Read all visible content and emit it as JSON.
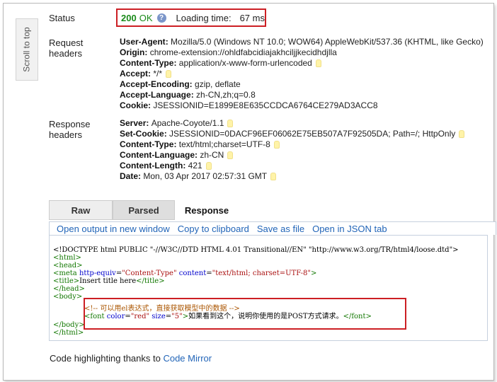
{
  "scroll_to_top": "Scroll to top",
  "status": {
    "label": "Status",
    "code": "200",
    "text": "OK",
    "loading_label": "Loading time:",
    "loading_value": "67 ms"
  },
  "request_headers": {
    "label_line1": "Request",
    "label_line2": "headers",
    "items": [
      {
        "name": "User-Agent",
        "value": "Mozilla/5.0 (Windows NT 10.0; WOW64) AppleWebKit/537.36 (KHTML, like Gecko)",
        "bulb": false
      },
      {
        "name": "Origin",
        "value": "chrome-extension://ohldfabcidiajakhciljjkecidhdjlla",
        "bulb": false
      },
      {
        "name": "Content-Type",
        "value": "application/x-www-form-urlencoded",
        "bulb": true
      },
      {
        "name": "Accept",
        "value": "*/*",
        "bulb": true
      },
      {
        "name": "Accept-Encoding",
        "value": "gzip, deflate",
        "bulb": false
      },
      {
        "name": "Accept-Language",
        "value": "zh-CN,zh;q=0.8",
        "bulb": false
      },
      {
        "name": "Cookie",
        "value": "JSESSIONID=E1899E8E635CCDCA6764CE279AD3ACC8",
        "bulb": false
      }
    ]
  },
  "response_headers": {
    "label_line1": "Response",
    "label_line2": "headers",
    "items": [
      {
        "name": "Server",
        "value": "Apache-Coyote/1.1",
        "bulb": true
      },
      {
        "name": "Set-Cookie",
        "value": "JSESSIONID=0DACF96EF06062E75EB507A7F92505DA; Path=/; HttpOnly",
        "bulb": true
      },
      {
        "name": "Content-Type",
        "value": "text/html;charset=UTF-8",
        "bulb": true
      },
      {
        "name": "Content-Language",
        "value": "zh-CN",
        "bulb": true
      },
      {
        "name": "Content-Length",
        "value": "421",
        "bulb": true
      },
      {
        "name": "Date",
        "value": "Mon, 03 Apr 2017 02:57:31 GMT",
        "bulb": true
      }
    ]
  },
  "tabs": {
    "raw": "Raw",
    "parsed": "Parsed",
    "response": "Response"
  },
  "toolbar": {
    "open_new_window": "Open output in new window",
    "copy_clipboard": "Copy to clipboard",
    "save_as_file": "Save as file",
    "open_json": "Open in JSON tab"
  },
  "code_lines": {
    "doctype": "<!DOCTYPE html PUBLIC \"-//W3C//DTD HTML 4.01 Transitional//EN\" \"http://www.w3.org/TR/html4/loose.dtd\">",
    "html_open": "<html>",
    "head_open": "<head>",
    "meta_tag_open": "<meta",
    "meta_attr1": " http-equiv",
    "meta_eq1": "=",
    "meta_str1": "\"Content-Type\"",
    "meta_attr2": " content",
    "meta_eq2": "=",
    "meta_str2": "\"text/html; charset=UTF-8\"",
    "meta_close": ">",
    "title_open": "<title>",
    "title_text": "Insert title here",
    "title_close": "</title>",
    "head_close": "</head>",
    "body_open": "<body>",
    "comment": "<!-- 可以用el表达式，直接获取模型中的数据 -->",
    "font_open": "<font",
    "font_attr1": " color",
    "font_eq1": "=",
    "font_str1": "\"red\"",
    "font_attr2": " size",
    "font_eq2": "=",
    "font_str2": "\"5\"",
    "font_gt": ">",
    "font_text": "如果看到这个，说明你使用的是POST方式请求。",
    "font_close": "</font>",
    "body_close": "</body>",
    "html_close": "</html>"
  },
  "footer": {
    "text": "Code highlighting thanks to ",
    "link": "Code Mirror"
  }
}
